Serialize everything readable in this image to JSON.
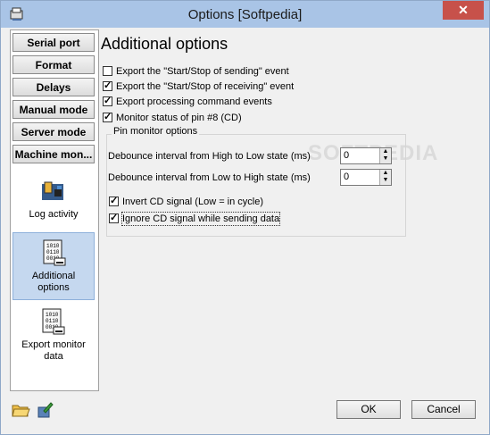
{
  "window": {
    "title": "Options [Softpedia]",
    "close_label": "✕"
  },
  "sidebar": {
    "nav_buttons": [
      {
        "label": "Serial port"
      },
      {
        "label": "Format"
      },
      {
        "label": "Delays"
      },
      {
        "label": "Manual mode"
      },
      {
        "label": "Server mode"
      },
      {
        "label": "Machine mon..."
      }
    ],
    "big_items": [
      {
        "label_line1": "Log activity",
        "label_line2": ""
      },
      {
        "label_line1": "Additional",
        "label_line2": "options"
      },
      {
        "label_line1": "Export monitor",
        "label_line2": "data"
      }
    ]
  },
  "main": {
    "heading": "Additional options",
    "options": [
      {
        "label": "Export the \"Start/Stop of sending\" event",
        "checked": false
      },
      {
        "label": "Export the \"Start/Stop of receiving\" event",
        "checked": true
      },
      {
        "label": "Export processing command events",
        "checked": true
      },
      {
        "label": "Monitor status of pin #8 (CD)",
        "checked": true
      }
    ],
    "pin_group": {
      "title": "Pin monitor options",
      "high_low_label": "Debounce interval from High to Low state (ms)",
      "high_low_value": "0",
      "low_high_label": "Debounce interval from Low to High state (ms)",
      "low_high_value": "0",
      "invert_label": "Invert CD signal (Low = in cycle)",
      "invert_checked": true,
      "ignore_label": "Ignore CD signal while sending data",
      "ignore_checked": true
    }
  },
  "footer": {
    "ok_label": "OK",
    "cancel_label": "Cancel"
  },
  "watermark": "SOFTPEDIA",
  "colors": {
    "titlebar": "#a9c4e6",
    "close": "#c7514a",
    "selected": "#c5d8ef"
  }
}
